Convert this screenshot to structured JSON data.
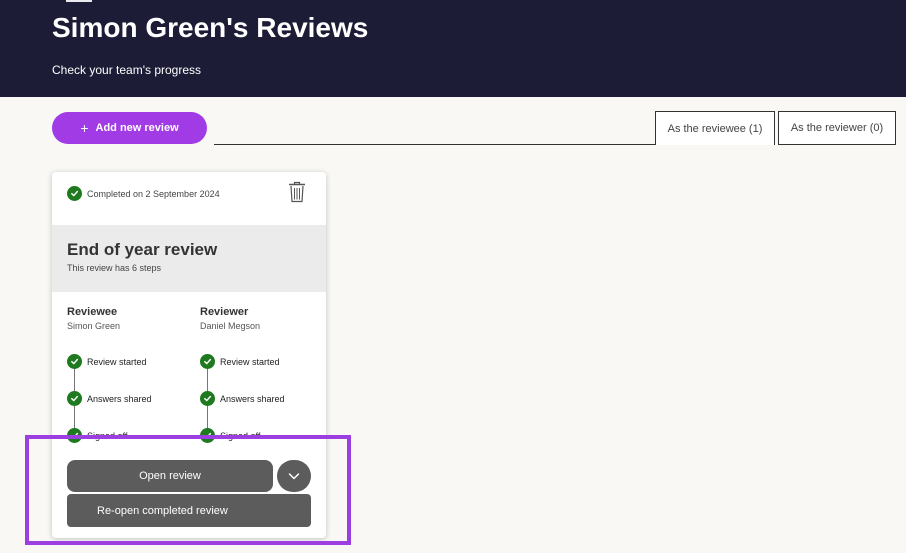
{
  "header": {
    "title": "Simon Green's Reviews",
    "subtitle": "Check your team's progress",
    "background_color": "#1d1c37"
  },
  "toolbar": {
    "add_icon": "plus-icon",
    "add_label": "Add new review",
    "add_color": "#a13be6"
  },
  "tabs": [
    {
      "label": "As the reviewee (1)",
      "active": true
    },
    {
      "label": "As the reviewer (0)",
      "active": false
    }
  ],
  "review_card": {
    "status_icon": "check-circle-icon",
    "status_text": "Completed on 2 September 2024",
    "delete_icon": "trash-icon",
    "title": "End of year review",
    "steps_text": "This review has 6 steps",
    "reviewee": {
      "role": "Reviewee",
      "name": "Simon Green",
      "steps": [
        "Review started",
        "Answers shared",
        "Signed off"
      ]
    },
    "reviewer": {
      "role": "Reviewer",
      "name": "Daniel Megson",
      "steps": [
        "Review started",
        "Answers shared",
        "Signed off"
      ]
    },
    "open_label": "Open review",
    "dropdown_icon": "chevron-down-icon",
    "menu_item": "Re-open completed review",
    "step_color": "#1f7a1f"
  },
  "highlight_color": "#9b3fe0"
}
